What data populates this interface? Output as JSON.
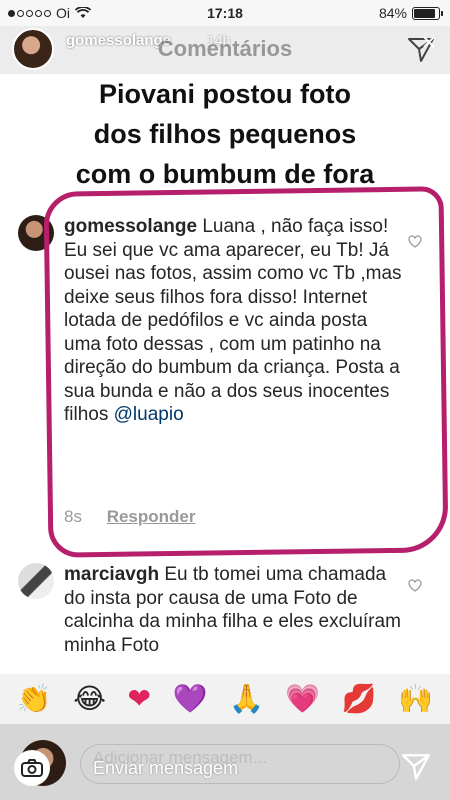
{
  "status_bar": {
    "carrier": "Oi",
    "time": "17:18",
    "battery": "84%"
  },
  "story": {
    "username": "gomessolange",
    "time_ago": "14h",
    "panel_title": "Comentários",
    "caption_lines": [
      "Piovani postou foto",
      "dos filhos pequenos",
      "com o bumbum de fora"
    ]
  },
  "comments": [
    {
      "username": "gomessolange",
      "text": " Luana , não faça isso! Eu sei que vc ama aparecer, eu Tb! Já ousei nas fotos, assim como vc Tb ,mas deixe seus filhos fora disso! Internet lotada de pedófilos e vc ainda posta uma foto dessas , com um patinho na direção do bumbum da criança. Posta a sua bunda e não a dos seus inocentes filhos ",
      "mention": "@luapio",
      "time": "8s",
      "reply_label": "Responder"
    },
    {
      "username": "marciavgh",
      "text": " Eu tb tomei uma chamada do insta por causa de uma Foto de calcinha da minha filha e eles excluíram minha Foto"
    }
  ],
  "emoji_bar": [
    "👏",
    "😂",
    "❤",
    "💜",
    "🙏",
    "💗",
    "💋",
    "🙌"
  ],
  "bottom_bar": {
    "placeholder_ghost": "Adicionar mensagem...",
    "placeholder": "Enviar mensagem"
  },
  "colors": {
    "highlight": "#b51f6b",
    "mention": "#003569"
  }
}
